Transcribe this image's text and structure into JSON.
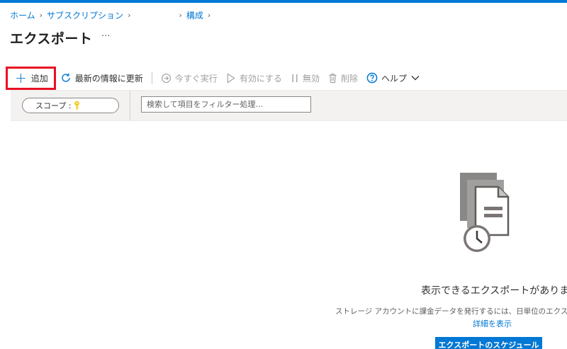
{
  "breadcrumb": {
    "home": "ホーム",
    "subscriptions": "サブスクリプション",
    "config": "構成"
  },
  "page": {
    "title": "エクスポート",
    "more": "···"
  },
  "toolbar": {
    "add": "追加",
    "refresh": "最新の情報に更新",
    "run_now": "今すぐ実行",
    "enable": "有効にする",
    "disable": "無効",
    "delete": "削除",
    "help": "ヘルプ"
  },
  "filter": {
    "scope_label": "スコープ :",
    "search_placeholder": "検索して項目をフィルター処理..."
  },
  "empty_state": {
    "title": "表示できるエクスポートがありません",
    "description": "ストレージ アカウントに課金データを発行するには、日単位のエクスポ",
    "learn_more": "詳細を表示",
    "schedule_button": "エクスポートのスケジュール"
  },
  "colors": {
    "accent": "#0078d4",
    "highlight_box": "#e81123",
    "scope_key": "#f2c811"
  },
  "icons": {
    "add": "plus-icon",
    "refresh": "refresh-icon",
    "run_now": "run-circle-icon",
    "enable": "play-icon",
    "disable": "pause-icon",
    "delete": "trash-icon",
    "help": "question-circle-icon",
    "help_menu": "chevron-down-icon",
    "scope": "key-icon",
    "empty": "scheduled-documents-icon"
  }
}
